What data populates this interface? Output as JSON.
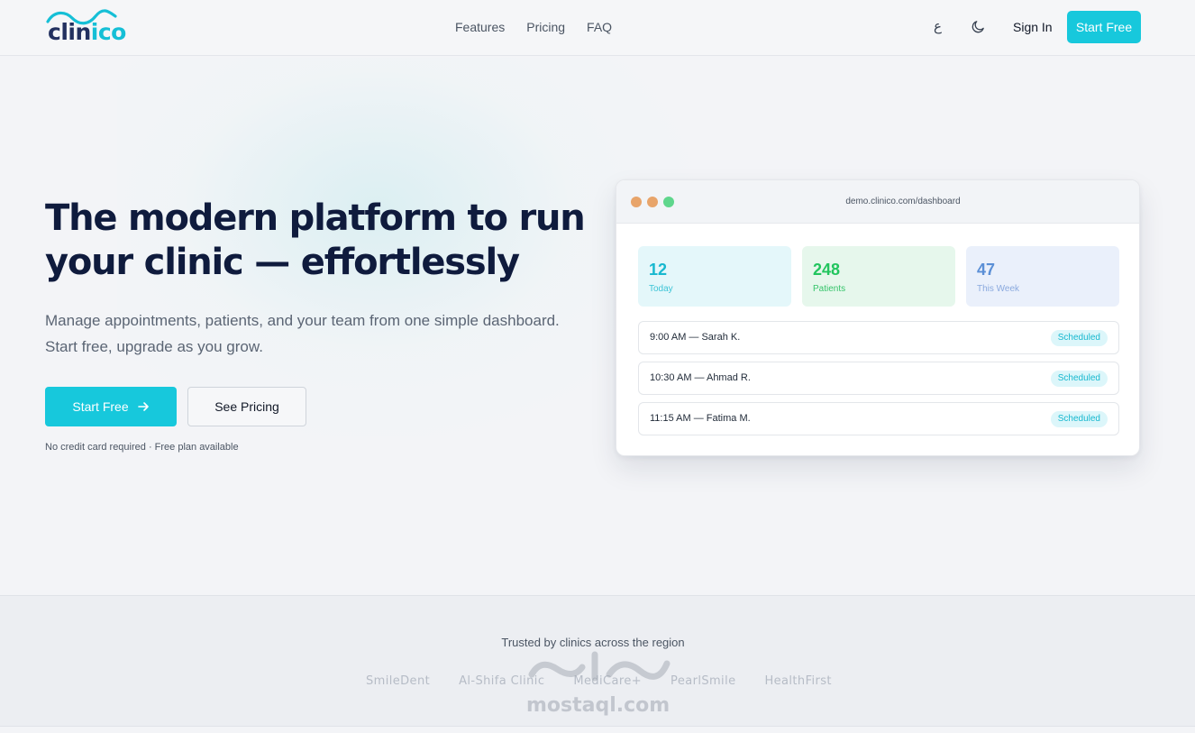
{
  "nav": {
    "logo": {
      "part1": "clin",
      "part2": "ico"
    },
    "links": [
      "Features",
      "Pricing",
      "FAQ"
    ],
    "lang_label": "ع",
    "sign_in": "Sign In",
    "cta": "Start Free"
  },
  "hero": {
    "title_line1": "The modern platform to run",
    "title_line2": "your clinic — effortlessly",
    "sub_line1": "Manage appointments, patients, and your team from one simple dashboard.",
    "sub_line2": "Start free, upgrade as you grow.",
    "primary_cta": "Start Free",
    "secondary_cta": "See Pricing",
    "note": "No credit card required · Free plan available"
  },
  "mock": {
    "url": "demo.clinico.com/dashboard",
    "stats": [
      {
        "value": "12",
        "label": "Today"
      },
      {
        "value": "248",
        "label": "Patients"
      },
      {
        "value": "47",
        "label": "This Week"
      }
    ],
    "appointments": [
      {
        "text": "9:00 AM — Sarah K.",
        "status": "Scheduled"
      },
      {
        "text": "10:30 AM — Ahmad R.",
        "status": "Scheduled"
      },
      {
        "text": "11:15 AM — Fatima M.",
        "status": "Scheduled"
      }
    ]
  },
  "trusted": {
    "title": "Trusted by clinics across the region",
    "logos": [
      "SmileDent",
      "Al-Shifa Clinic",
      "MediCare+",
      "PearlSmile",
      "HealthFirst"
    ]
  },
  "watermark": {
    "text": "mostaql.com"
  },
  "colors": {
    "accent": "#17c8dc",
    "navy": "#0f1b3d",
    "green": "#22c55e",
    "blue": "#5b8fd6"
  }
}
